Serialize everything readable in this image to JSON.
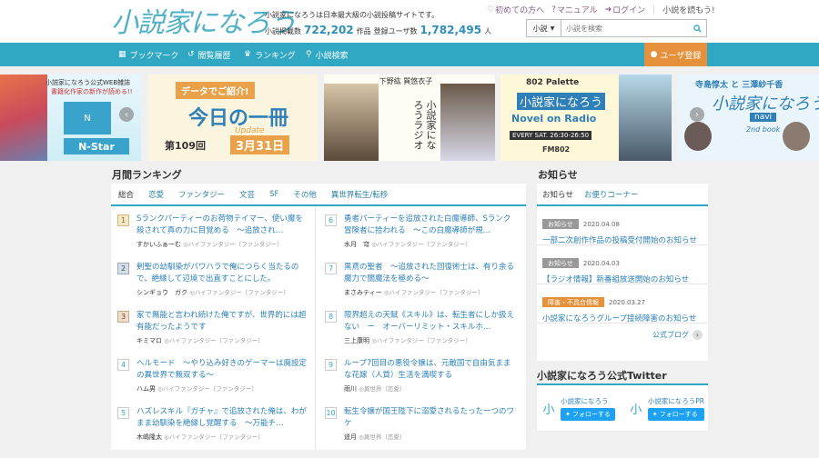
{
  "header": {
    "logo_text": "小説家になろう",
    "description": "小説家になろうは日本最大級の小説投稿サイトです。",
    "works_label": "小説掲載数",
    "works_count": "722,202",
    "works_unit": "作品",
    "users_label": "登録ユーザ数",
    "users_count": "1,782,495",
    "users_unit": "人",
    "links": {
      "beginner": "初めての方へ",
      "manual": "マニュアル",
      "login": "ログイン"
    },
    "yomu": "小説を読もう!",
    "search": {
      "select": "小説",
      "placeholder": "小説を検索"
    }
  },
  "nav": {
    "bookmark": "ブックマーク",
    "history": "閲覧履歴",
    "ranking": "ランキング",
    "search": "小説検索",
    "register": "ユーザ登録"
  },
  "banners": {
    "b1_line1": "小説家になろう公式WEB雑誌",
    "b1_line2": "書籍化作家の新作が読める!!",
    "b1_logo": "N-Star",
    "b2_top": "データでご紹介!",
    "b2_main": "今日の一冊",
    "b2_update": "Update",
    "b2_no": "第109回",
    "b2_date": "3月31日",
    "b3_people": "下野紘 巽悠衣子",
    "b3_title": "小説家になろうラジオ",
    "b4_top": "802 Palette",
    "b4_title": "小説家になろう",
    "b4_sub": "Novel on Radio",
    "b4_time": "EVERY SAT. 26:30-26:50",
    "b4_station": "FM802",
    "b5_people": "寺島惇太 と 三澤紗千香",
    "b5_title": "小説家になろう",
    "b5_navi": "navi",
    "b5_book": "2nd book"
  },
  "ranking": {
    "heading": "月間ランキング",
    "tabs": [
      "総合",
      "恋愛",
      "ファンタジー",
      "文芸",
      "SF",
      "その他",
      "異世界転生/転移"
    ],
    "items": [
      {
        "num": "1",
        "title": "Sランクパーティーのお荷物テイマー、使い魔を殺されて真の力に目覚める　～追放され…",
        "author": "すかいふぁーむ",
        "genre": "ハイファンタジー〔ファンタジー〕"
      },
      {
        "num": "2",
        "title": "剣聖の幼馴染がパワハラで俺につらく当たるので、絶縁して辺境で出直すことにした。",
        "author": "シンギョウ　ガク",
        "genre": "ハイファンタジー〔ファンタジー〕"
      },
      {
        "num": "3",
        "title": "家で無能と言われ続けた俺ですが、世界的には超有能だったようです",
        "author": "キミマロ",
        "genre": "ハイファンタジー〔ファンタジー〕"
      },
      {
        "num": "4",
        "title": "ヘルモード　～やり込み好きのゲーマーは廃設定の異世界で無双する～",
        "author": "ハム男",
        "genre": "ハイファンタジー〔ファンタジー〕"
      },
      {
        "num": "5",
        "title": "ハズレスキル『ガチャ』で追放された俺は、わがまま幼馴染を絶縁し覚醒する　～万能チ…",
        "author": "木嶋隆太",
        "genre": "ハイファンタジー〔ファンタジー〕"
      },
      {
        "num": "6",
        "title": "勇者パーティーを追放された白魔導師、Sランク冒険者に拾われる　～この白魔導師が規…",
        "author": "水月　穹",
        "genre": "ハイファンタジー〔ファンタジー〕"
      },
      {
        "num": "7",
        "title": "黒鳶の聖者　～追放された回復術士は、有り余る魔力で闇魔法を極める～",
        "author": "まさみティー",
        "genre": "ハイファンタジー〔ファンタジー〕"
      },
      {
        "num": "8",
        "title": "限界超えの天賦《スキル》は、転生者にしか扱えない　ー　オーバーリミット・スキルホ…",
        "author": "三上康明",
        "genre": "ハイファンタジー〔ファンタジー〕"
      },
      {
        "num": "9",
        "title": "ループ7回目の悪役令嬢は、元敵国で自由気ままな花嫁（人質）生活を満喫する",
        "author": "雨川",
        "genre": "異世界〔恋愛〕"
      },
      {
        "num": "10",
        "title": "転生令嬢が国王陛下に溺愛されるたった一つのワケ",
        "author": "遥月",
        "genre": "異世界〔恋愛〕"
      }
    ]
  },
  "notice": {
    "heading": "お知らせ",
    "tabs": [
      "お知らせ",
      "お便りコーナー"
    ],
    "items": [
      {
        "badge": "お知らせ",
        "date": "2020.04.08",
        "title": "一部二次創作作品の投稿受付開始のお知らせ"
      },
      {
        "badge": "お知らせ",
        "date": "2020.04.03",
        "title": "【ラジオ情報】新番組放送開始のお知らせ"
      },
      {
        "badge": "障害・不具合情報",
        "date": "2020.03.27",
        "title": "小説家になろうグループ接続障害のお知らせ"
      }
    ],
    "blog": "公式ブログ"
  },
  "twitter": {
    "heading": "小説家になろう公式Twitter",
    "accounts": [
      {
        "name": "小説家になろう",
        "follow": "フォローする"
      },
      {
        "name": "小説家になろうPR",
        "follow": "フォローする"
      }
    ]
  },
  "colors": {
    "accent": "#30a8c4",
    "orange": "#e5913b",
    "link": "#2a7fb8"
  }
}
